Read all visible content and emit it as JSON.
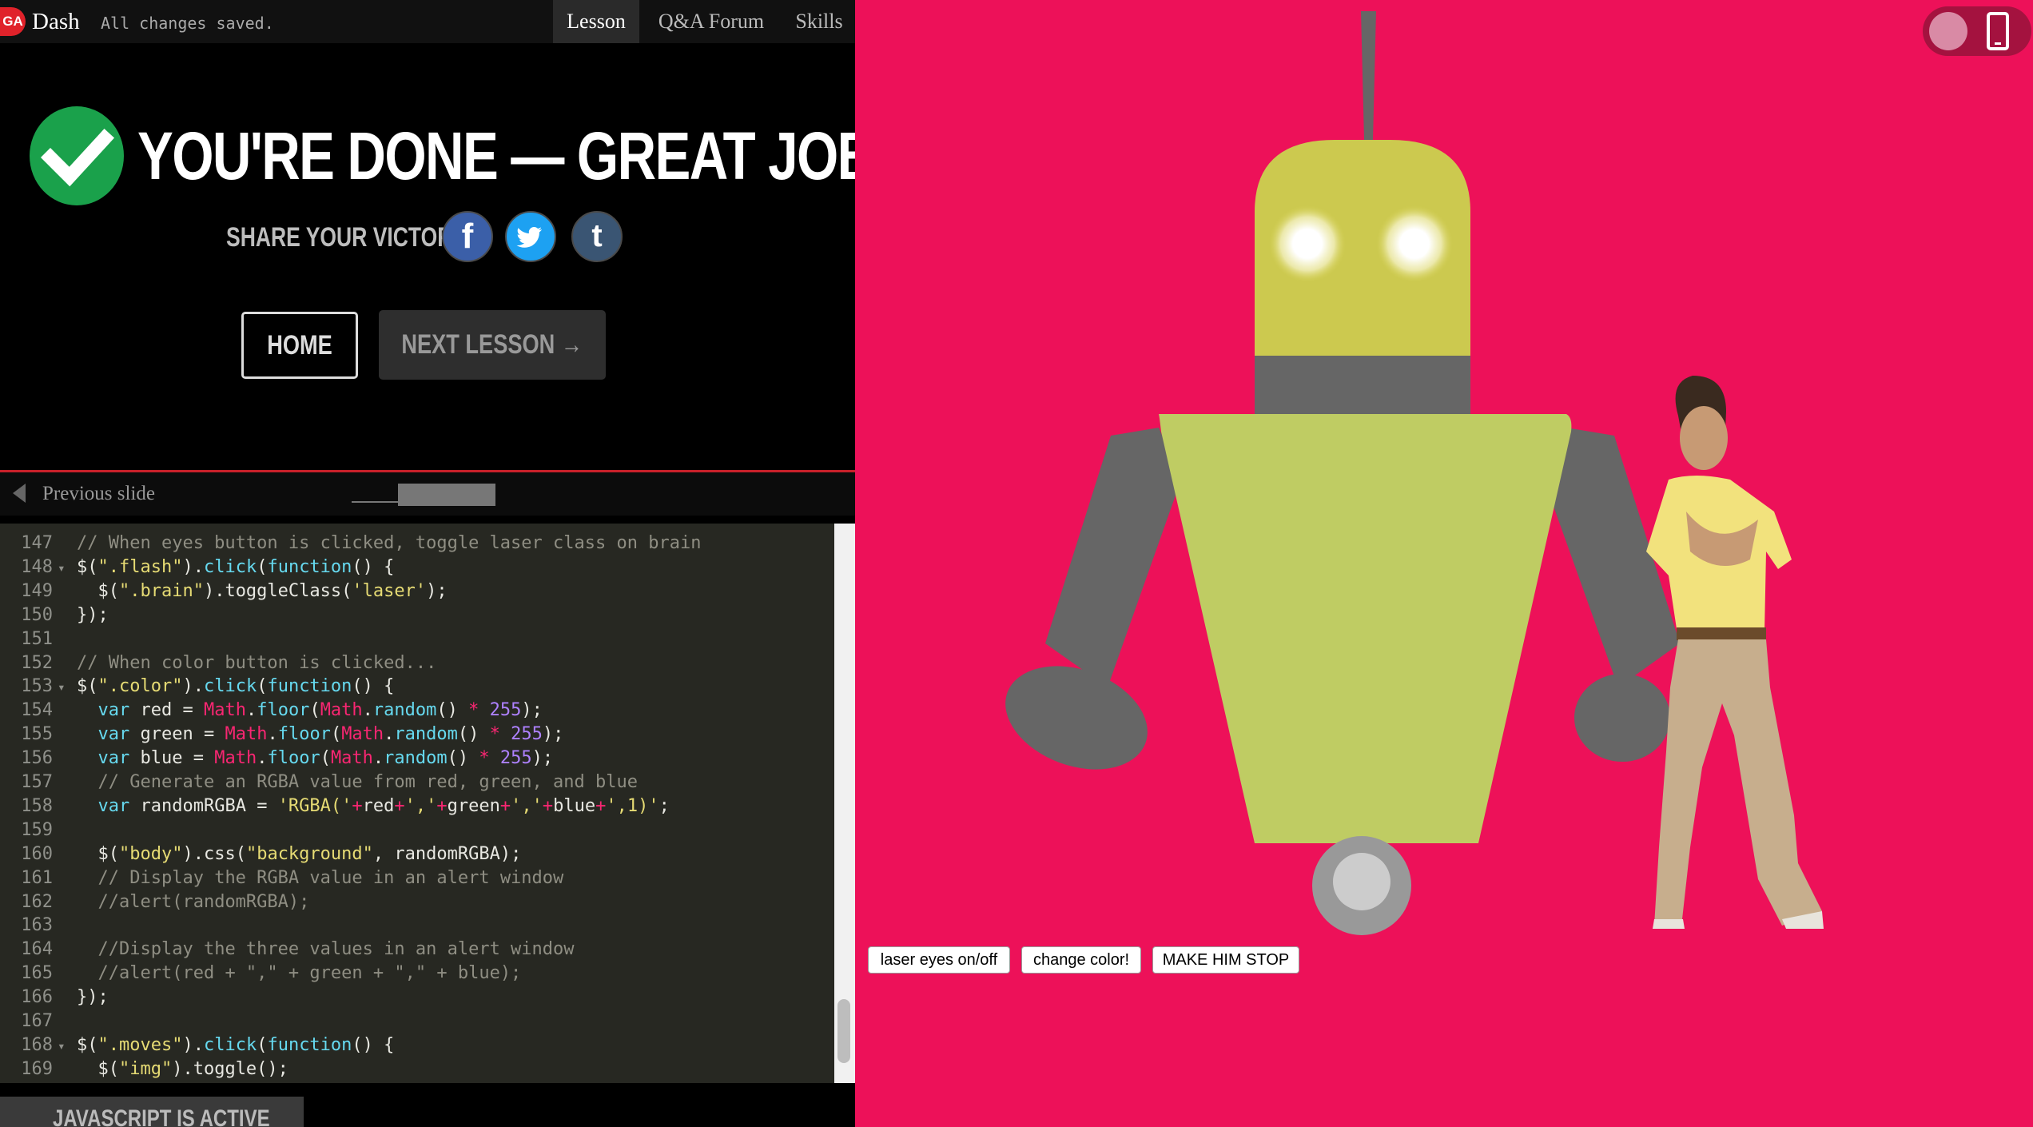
{
  "topbar": {
    "logo": "GA",
    "app_name": "Dash",
    "save_status": "All changes saved.",
    "tabs": [
      "Lesson",
      "Q&A Forum",
      "Skills"
    ]
  },
  "completion": {
    "title": "YOU'RE DONE — GREAT JOB!",
    "share_label": "SHARE YOUR VICTORY:",
    "share_icons": [
      "facebook-icon",
      "twitter-icon",
      "tumblr-icon"
    ],
    "share_glyphs": {
      "facebook": "f",
      "tumblr": "t"
    },
    "home_label": "HOME",
    "next_label": "NEXT LESSON →"
  },
  "slide_nav": {
    "previous_label": "Previous slide"
  },
  "editor": {
    "lines": [
      {
        "n": "147",
        "fold": false,
        "html": "<span class='c-com'>// When eyes button is clicked, toggle laser class on brain</span>"
      },
      {
        "n": "148",
        "fold": true,
        "html": "$(<span class='c-str'>\".flash\"</span>).<span class='c-fn'>click</span>(<span class='c-fn'>function</span>() {"
      },
      {
        "n": "149",
        "fold": false,
        "html": "  $(<span class='c-str'>\".brain\"</span>).toggleClass(<span class='c-str'>'laser'</span>);"
      },
      {
        "n": "150",
        "fold": false,
        "html": "});"
      },
      {
        "n": "151",
        "fold": false,
        "html": ""
      },
      {
        "n": "152",
        "fold": false,
        "html": "<span class='c-com'>// When color button is clicked...</span>"
      },
      {
        "n": "153",
        "fold": true,
        "html": "$(<span class='c-str'>\".color\"</span>).<span class='c-fn'>click</span>(<span class='c-fn'>function</span>() {"
      },
      {
        "n": "154",
        "fold": false,
        "html": "  <span class='c-fn'>var</span> red = <span class='c-kw'>Math</span>.<span class='c-fn'>floor</span>(<span class='c-kw'>Math</span>.<span class='c-fn'>random</span>() <span class='c-kw'>*</span> <span class='c-num'>255</span>);"
      },
      {
        "n": "155",
        "fold": false,
        "html": "  <span class='c-fn'>var</span> green = <span class='c-kw'>Math</span>.<span class='c-fn'>floor</span>(<span class='c-kw'>Math</span>.<span class='c-fn'>random</span>() <span class='c-kw'>*</span> <span class='c-num'>255</span>);"
      },
      {
        "n": "156",
        "fold": false,
        "html": "  <span class='c-fn'>var</span> blue = <span class='c-kw'>Math</span>.<span class='c-fn'>floor</span>(<span class='c-kw'>Math</span>.<span class='c-fn'>random</span>() <span class='c-kw'>*</span> <span class='c-num'>255</span>);"
      },
      {
        "n": "157",
        "fold": false,
        "html": "  <span class='c-com'>// Generate an RGBA value from red, green, and blue</span>"
      },
      {
        "n": "158",
        "fold": false,
        "html": "  <span class='c-fn'>var</span> randomRGBA = <span class='c-str'>'RGBA('</span><span class='c-kw'>+</span>red<span class='c-kw'>+</span><span class='c-str'>','</span><span class='c-kw'>+</span>green<span class='c-kw'>+</span><span class='c-str'>','</span><span class='c-kw'>+</span>blue<span class='c-kw'>+</span><span class='c-str'>',1)'</span>;"
      },
      {
        "n": "159",
        "fold": false,
        "html": ""
      },
      {
        "n": "160",
        "fold": false,
        "html": "  $(<span class='c-str'>\"body\"</span>).css(<span class='c-str'>\"background\"</span>, randomRGBA);"
      },
      {
        "n": "161",
        "fold": false,
        "html": "  <span class='c-com'>// Display the RGBA value in an alert window</span>"
      },
      {
        "n": "162",
        "fold": false,
        "html": "  <span class='c-com'>//alert(randomRGBA);</span>"
      },
      {
        "n": "163",
        "fold": false,
        "html": ""
      },
      {
        "n": "164",
        "fold": false,
        "html": "  <span class='c-com'>//Display the three values in an alert window</span>"
      },
      {
        "n": "165",
        "fold": false,
        "html": "  <span class='c-com'>//alert(red + \",\" + green + \",\" + blue);</span>"
      },
      {
        "n": "166",
        "fold": false,
        "html": "});"
      },
      {
        "n": "167",
        "fold": false,
        "html": ""
      },
      {
        "n": "168",
        "fold": true,
        "html": "$(<span class='c-str'>\".moves\"</span>).<span class='c-fn'>click</span>(<span class='c-fn'>function</span>() {"
      },
      {
        "n": "169",
        "fold": false,
        "html": "  $(<span class='c-str'>\"img\"</span>).toggle();"
      }
    ]
  },
  "mode_tab": "JAVASCRIPT IS ACTIVE",
  "preview": {
    "background": "#ed1159",
    "buttons": [
      "laser eyes on/off",
      "change color!",
      "MAKE HIM STOP"
    ]
  }
}
